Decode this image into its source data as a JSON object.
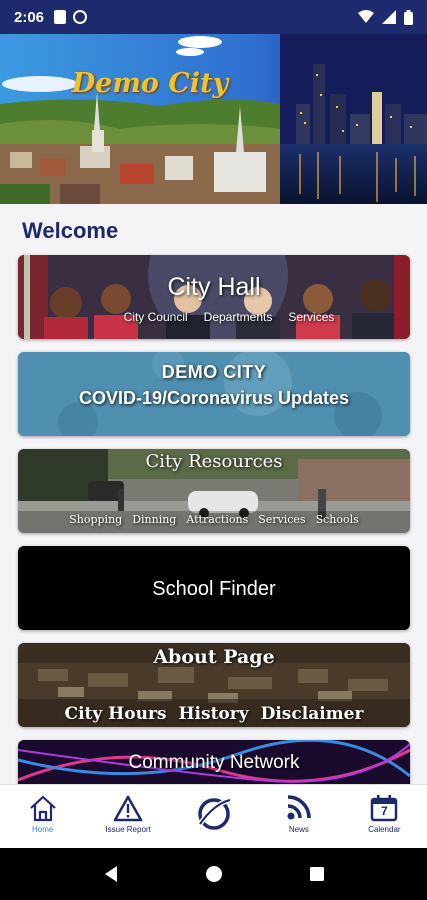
{
  "status_bar": {
    "time": "2:06"
  },
  "header": {
    "title": "Demo City"
  },
  "welcome": "Welcome",
  "tiles": [
    {
      "title": "City Hall",
      "links": [
        "City Council",
        "Departments",
        "Services"
      ]
    },
    {
      "title": "DEMO CITY",
      "subtitle": "COVID-19/Coronavirus Updates"
    },
    {
      "title": "City   Resources",
      "links": [
        "Shopping",
        "Dinning",
        "Attractions",
        "Services",
        "Schools"
      ]
    },
    {
      "title": "School Finder"
    },
    {
      "title": "About Page",
      "links": [
        "City Hours",
        "History",
        "Disclaimer"
      ]
    },
    {
      "title": "Community Network"
    }
  ],
  "bottom_nav": [
    {
      "label": "Home",
      "icon": "home-icon",
      "active": true
    },
    {
      "label": "Issue Report",
      "icon": "warning-icon",
      "active": false
    },
    {
      "label": "",
      "icon": "app-logo-icon",
      "active": false
    },
    {
      "label": "News",
      "icon": "rss-icon",
      "active": false
    },
    {
      "label": "Calendar",
      "icon": "calendar-icon",
      "active": false,
      "badge": "7"
    }
  ],
  "colors": {
    "status_bar": "#1e2a6e",
    "brand_navy": "#1c2a6b",
    "active": "#3b82f6",
    "covid_tile": "#4a8fb0",
    "title_gold": "#f2c12e"
  }
}
